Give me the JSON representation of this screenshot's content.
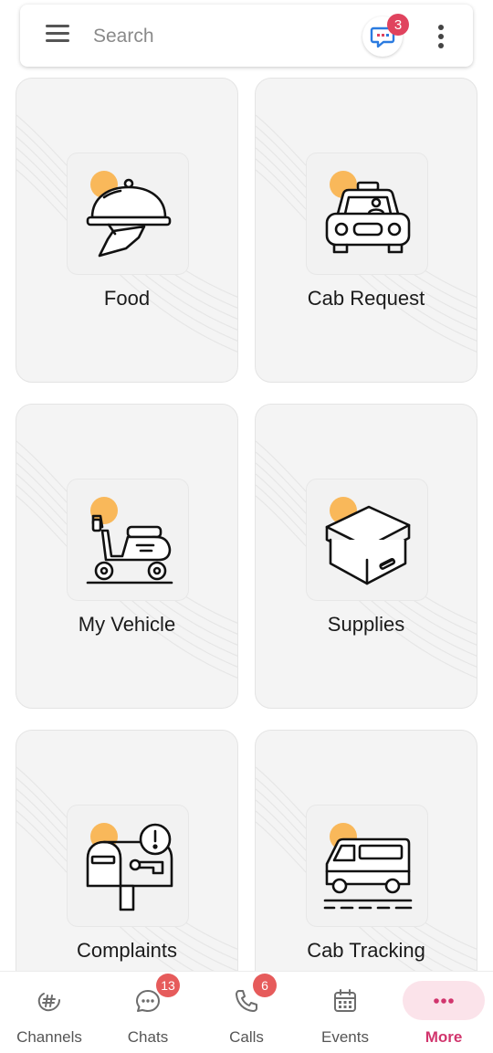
{
  "search": {
    "placeholder": "Search",
    "notification_count": "3"
  },
  "cards": [
    {
      "label": "Food",
      "icon": "food-cloche-icon"
    },
    {
      "label": "Cab Request",
      "icon": "taxi-icon"
    },
    {
      "label": "My Vehicle",
      "icon": "scooter-icon"
    },
    {
      "label": "Supplies",
      "icon": "box-icon"
    },
    {
      "label": "Complaints",
      "icon": "mailbox-alert-icon"
    },
    {
      "label": "Cab Tracking",
      "icon": "van-icon"
    }
  ],
  "nav": {
    "channels": {
      "label": "Channels",
      "icon": "channels-hash-icon"
    },
    "chats": {
      "label": "Chats",
      "badge": "13",
      "icon": "chat-bubble-icon"
    },
    "calls": {
      "label": "Calls",
      "badge": "6",
      "icon": "phone-icon"
    },
    "events": {
      "label": "Events",
      "icon": "calendar-icon"
    },
    "more": {
      "label": "More",
      "icon": "more-dots-icon"
    }
  },
  "colors": {
    "accent": "#d1356d",
    "badge": "#e0435e",
    "sun": "#f9b85a",
    "card_bg": "#f4f4f4"
  }
}
